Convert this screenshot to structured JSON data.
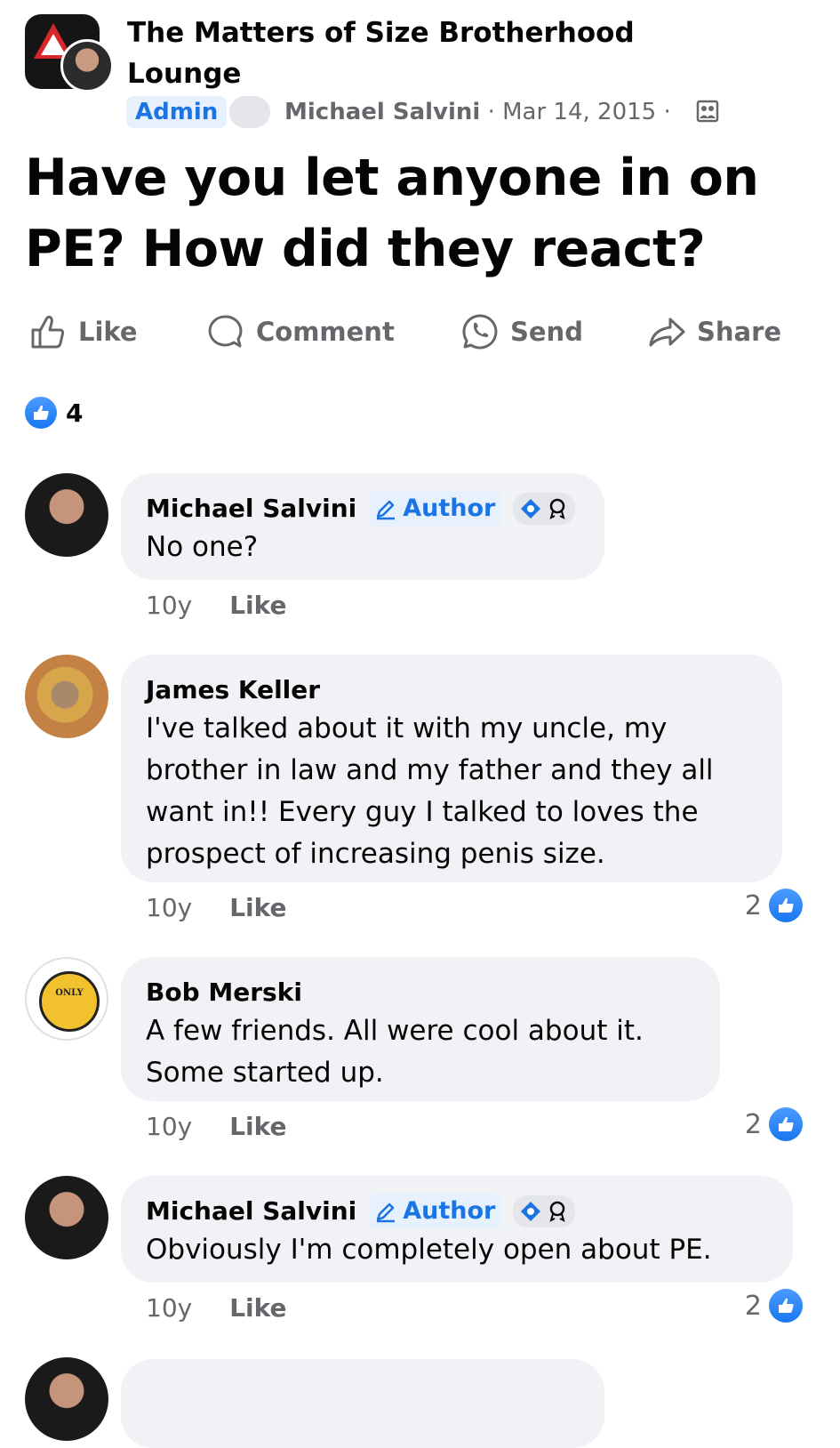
{
  "group": {
    "name": "The Matters of Size Brotherhood Lounge",
    "avatar_icon": "warning-sign-logo",
    "role_badge": "Admin"
  },
  "post": {
    "author": "Michael Salvini",
    "date": "Mar 14, 2015",
    "separator": "·",
    "privacy_icon": "group-members-icon",
    "title": "Have you let anyone in on PE? How did they react?",
    "reaction_count": "4"
  },
  "actions": {
    "like": "Like",
    "comment": "Comment",
    "send": "Send",
    "share": "Share"
  },
  "comments": [
    {
      "name": "Michael Salvini",
      "author_tag": "Author",
      "text": "No one?",
      "age": "10y",
      "like": "Like",
      "likes": ""
    },
    {
      "name": "James Keller",
      "text": "I've talked about it with my uncle, my brother in law and my father and they all want in!! Every guy I talked to loves the prospect of increasing penis size.",
      "age": "10y",
      "like": "Like",
      "likes": "2"
    },
    {
      "name": "Bob Merski",
      "text": "A few friends. All were cool about it. Some started up.",
      "age": "10y",
      "like": "Like",
      "likes": "2"
    },
    {
      "name": "Michael Salvini",
      "author_tag": "Author",
      "text": "Obviously I'm completely open about PE.",
      "age": "10y",
      "like": "Like",
      "likes": "2"
    }
  ],
  "colors": {
    "accent": "#1877f2",
    "muted_text": "#65676b",
    "bubble_bg": "#f0f2f5"
  }
}
